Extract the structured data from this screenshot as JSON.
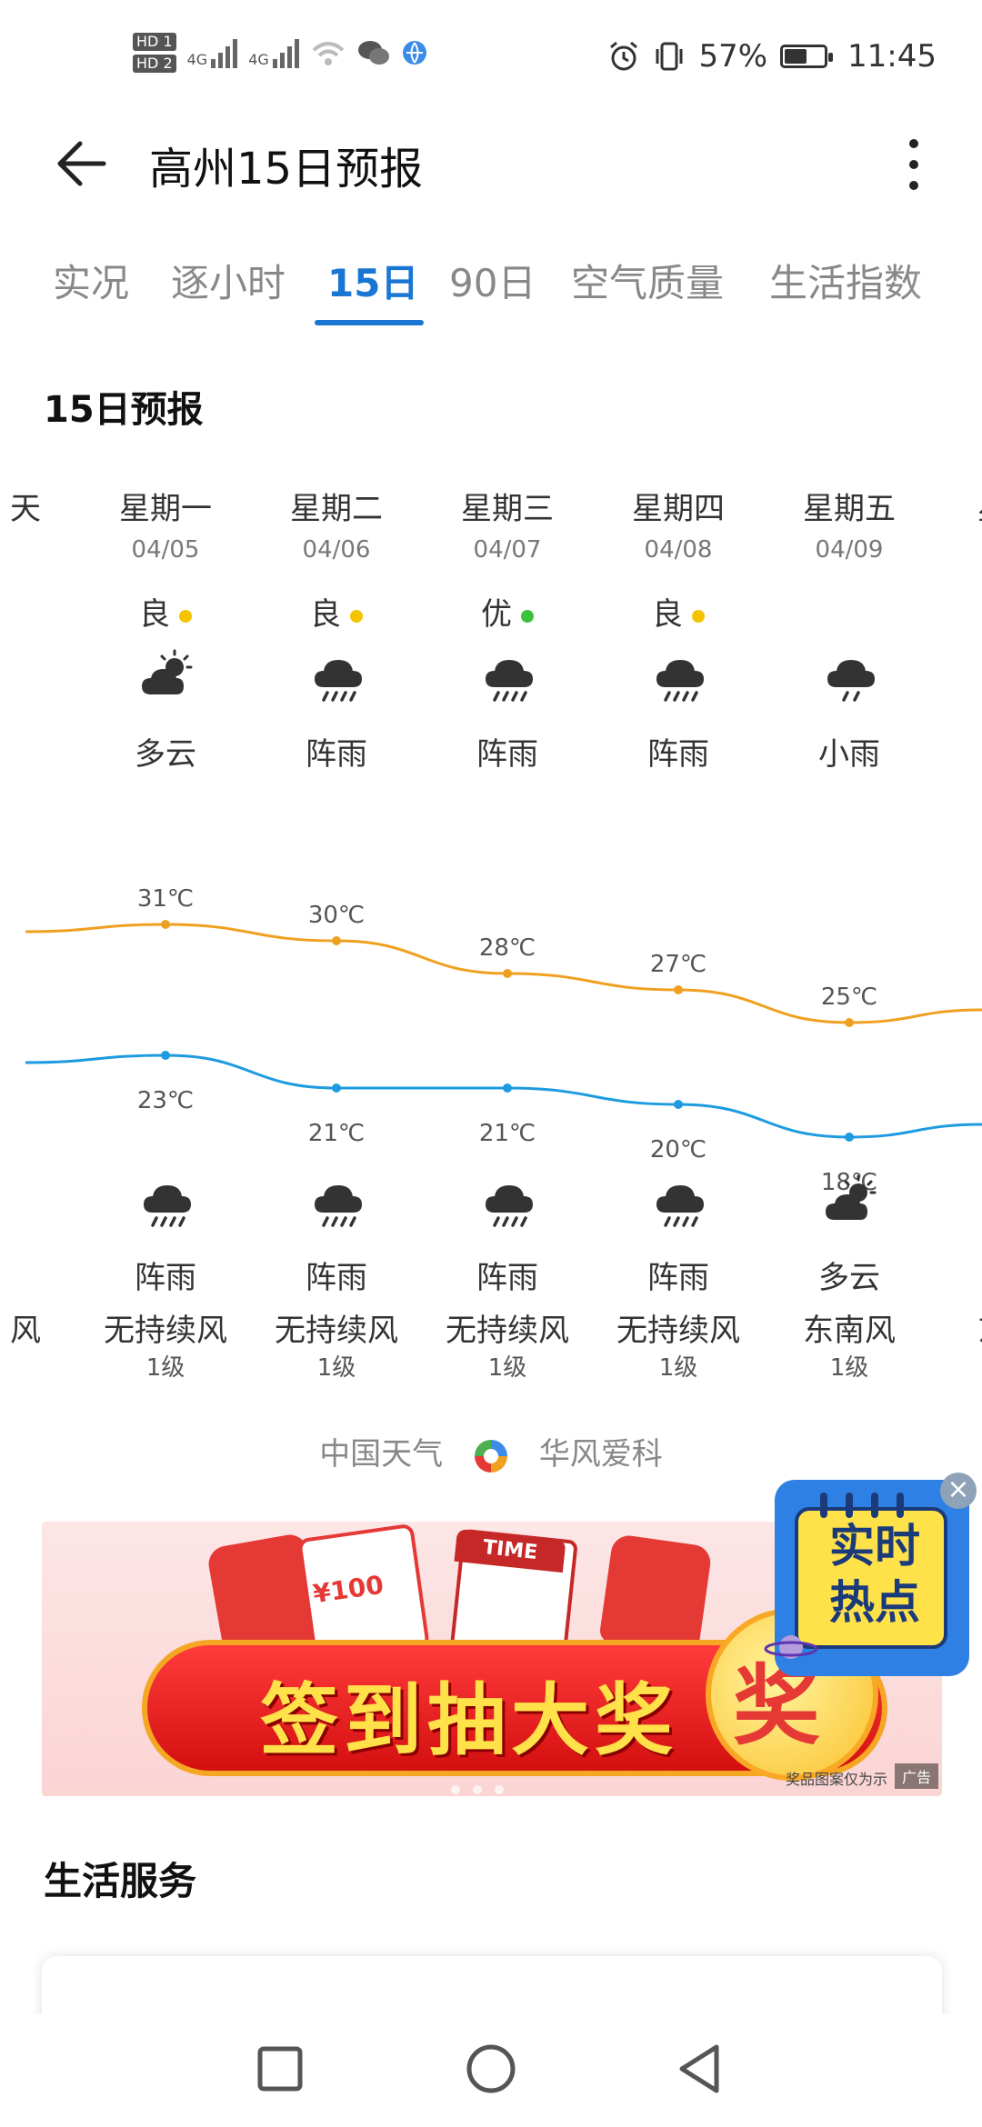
{
  "status_bar": {
    "sim1": "HD 1",
    "sim2": "HD 2",
    "net1": "4G",
    "net2": "4G",
    "battery_percent": "57%",
    "battery_level": 0.57,
    "time": "11:45",
    "icons": [
      "wifi-icon",
      "wechat-icon",
      "browser-icon",
      "alarm-icon",
      "vibrate-icon"
    ]
  },
  "header": {
    "title": "高州15日预报"
  },
  "tabs": [
    "实况",
    "逐小时",
    "15日",
    "90日",
    "空气质量",
    "生活指数"
  ],
  "active_tab": "15日",
  "section_title": "15日预报",
  "forecast": {
    "partial_left": {
      "dow": "天",
      "wind": "风"
    },
    "days": [
      {
        "dow": "星期一",
        "date": "04/05",
        "aq": "良",
        "aq_color": "#f5c400",
        "day_weather": "多云",
        "day_icon": "partly-cloudy-icon",
        "night_weather": "阵雨",
        "night_icon": "shower-icon",
        "wind": "无持续风",
        "level": "1级",
        "high": "31℃",
        "low": "23℃",
        "high_v": 31,
        "low_v": 23
      },
      {
        "dow": "星期二",
        "date": "04/06",
        "aq": "良",
        "aq_color": "#f5c400",
        "day_weather": "阵雨",
        "day_icon": "shower-icon",
        "night_weather": "阵雨",
        "night_icon": "shower-icon",
        "wind": "无持续风",
        "level": "1级",
        "high": "30℃",
        "low": "21℃",
        "high_v": 30,
        "low_v": 21
      },
      {
        "dow": "星期三",
        "date": "04/07",
        "aq": "优",
        "aq_color": "#3cc13b",
        "day_weather": "阵雨",
        "day_icon": "shower-icon",
        "night_weather": "阵雨",
        "night_icon": "shower-icon",
        "wind": "无持续风",
        "level": "1级",
        "high": "28℃",
        "low": "21℃",
        "high_v": 28,
        "low_v": 21
      },
      {
        "dow": "星期四",
        "date": "04/08",
        "aq": "良",
        "aq_color": "#f5c400",
        "day_weather": "阵雨",
        "day_icon": "shower-icon",
        "night_weather": "阵雨",
        "night_icon": "shower-icon",
        "wind": "无持续风",
        "level": "1级",
        "high": "27℃",
        "low": "20℃",
        "high_v": 27,
        "low_v": 20
      },
      {
        "dow": "星期五",
        "date": "04/09",
        "aq": "",
        "aq_color": "",
        "day_weather": "小雨",
        "day_icon": "light-rain-icon",
        "night_weather": "多云",
        "night_icon": "partly-cloudy-night-icon",
        "wind": "东南风",
        "level": "1级",
        "high": "25℃",
        "low": "18℃",
        "high_v": 25,
        "low_v": 18
      }
    ],
    "partial_right": {
      "dow": "星",
      "wind": "东"
    },
    "high_color": "#f0a020",
    "low_color": "#1e9be0"
  },
  "source": {
    "left": "中国天气",
    "right": "华风爱科"
  },
  "banner": {
    "main_text": "签到抽大奖",
    "coin_text": "奖",
    "card_text": "¥100",
    "calendar_text": "TIME",
    "disclaimer": "奖品图案仅为示",
    "ad_tag": "广告"
  },
  "hot_widget": {
    "text_line1": "实时",
    "text_line2": "热点",
    "close": "×"
  },
  "section2_title": "生活服务",
  "nav": [
    "recent-apps",
    "home",
    "back"
  ]
}
